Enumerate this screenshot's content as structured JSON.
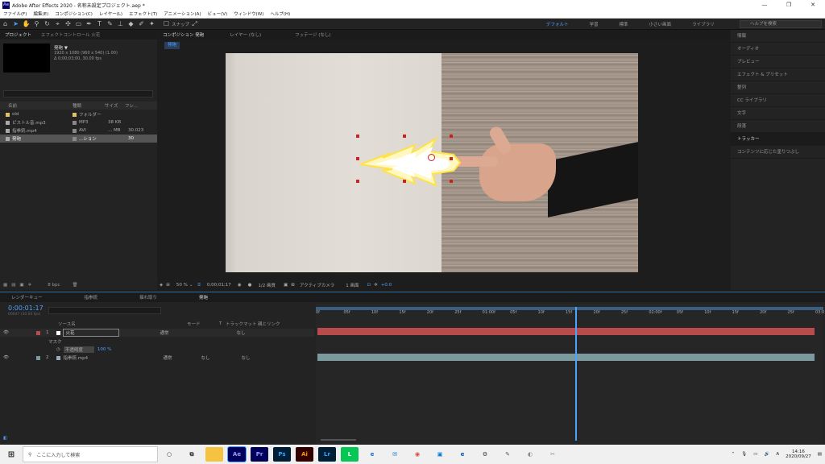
{
  "window": {
    "title": "Adobe After Effects 2020 - 名称未設定プロジェクト.aep *",
    "controls": [
      "—",
      "❐",
      "✕"
    ]
  },
  "menu": [
    "ファイル(F)",
    "編集(E)",
    "コンポジション(C)",
    "レイヤー(L)",
    "エフェクト(T)",
    "アニメーション(A)",
    "ビュー(V)",
    "ウィンドウ(W)",
    "ヘルプ(H)"
  ],
  "toolbar": {
    "snap_label": "スナップ",
    "workspaces": [
      "デフォルト",
      "学習",
      "標準",
      "小さい画面",
      "ライブラリ"
    ],
    "help_search_placeholder": "ヘルプを検索"
  },
  "project": {
    "tab_project": "プロジェクト",
    "tab_effect": "エフェクトコントロール 火花",
    "item_name": "発砲 ▼",
    "item_info1": "1920 x 1080 (960 x 540) (1.00)",
    "item_info2": "Δ 0;00;03;00, 30.00 fps",
    "columns": [
      "名前",
      "種類",
      "サイズ",
      "フレ..."
    ],
    "rows": [
      {
        "name": "old",
        "type": "フォルダー",
        "size": "",
        "fps": "",
        "color": "#e0c060"
      },
      {
        "name": "ピストル音.mp3",
        "type": "MP3",
        "size": "38 KB",
        "fps": "",
        "color": "#aaaaaa"
      },
      {
        "name": "指拳銃.mp4",
        "type": "AVI",
        "size": "... MB",
        "fps": "30.023",
        "color": "#aaaaaa"
      },
      {
        "name": "発砲",
        "type": "...ション",
        "size": "",
        "fps": "30",
        "color": "#aaaaaa"
      }
    ],
    "bpc": "8 bpc"
  },
  "composition": {
    "tab_label": "コンポジション 発砲",
    "tab_layer": "レイヤー (なし)",
    "tab_footage": "フッテージ (なし)",
    "comp_name": "発砲",
    "zoom": "50 %",
    "time": "0;00;01;17",
    "resolution": "1/2 画質",
    "camera": "アクティブカメラ",
    "views": "1 画面",
    "exposure": "+0.0"
  },
  "right_panel": {
    "items": [
      "情報",
      "オーディオ",
      "プレビュー",
      "エフェクト & プリセット",
      "整列",
      "CC ライブラリ",
      "文字",
      "段落",
      "トラッカー",
      "コンテンツに応じた塗りつぶし"
    ]
  },
  "timeline": {
    "tabs": [
      "レンダーキュー",
      "指拳銃",
      "揺れ取り",
      "発砲"
    ],
    "timecode": "0:00:01:17",
    "fps_info": "00047 (30.00 fps)",
    "columns": [
      "ソース名",
      "モード",
      "T",
      "トラックマット",
      "親とリンク"
    ],
    "layers": [
      {
        "num": "1",
        "name": "火花",
        "mode": "通常",
        "parent": "なし",
        "color": "#b84c4c"
      },
      {
        "num": "2",
        "name": "指拳銃.mp4",
        "mode": "通常",
        "trkmat": "なし",
        "parent": "なし",
        "color": "#7a9aa0"
      }
    ],
    "mask_label": "マスク",
    "opacity_label": "不透明度",
    "opacity_value": "100 %",
    "ruler": [
      "0f",
      "05f",
      "10f",
      "15f",
      "20f",
      "25f",
      "01:00f",
      "05f",
      "10f",
      "15f",
      "20f",
      "25f",
      "02:00f",
      "05f",
      "10f",
      "15f",
      "20f",
      "25f",
      "03:0"
    ],
    "playhead_fraction": 0.5111
  },
  "taskbar": {
    "search_placeholder": "ここに入力して検索",
    "apps": [
      {
        "label": "Ae",
        "bg": "#00005b",
        "fg": "#9999ff"
      },
      {
        "label": "Pr",
        "bg": "#00005b",
        "fg": "#9999ff"
      },
      {
        "label": "Ps",
        "bg": "#001e36",
        "fg": "#31a8ff"
      },
      {
        "label": "Ai",
        "bg": "#330000",
        "fg": "#ff9a00"
      },
      {
        "label": "Lr",
        "bg": "#001e36",
        "fg": "#31a8ff"
      }
    ],
    "time": "14:16",
    "date": "2020/09/27",
    "lang": "A"
  }
}
